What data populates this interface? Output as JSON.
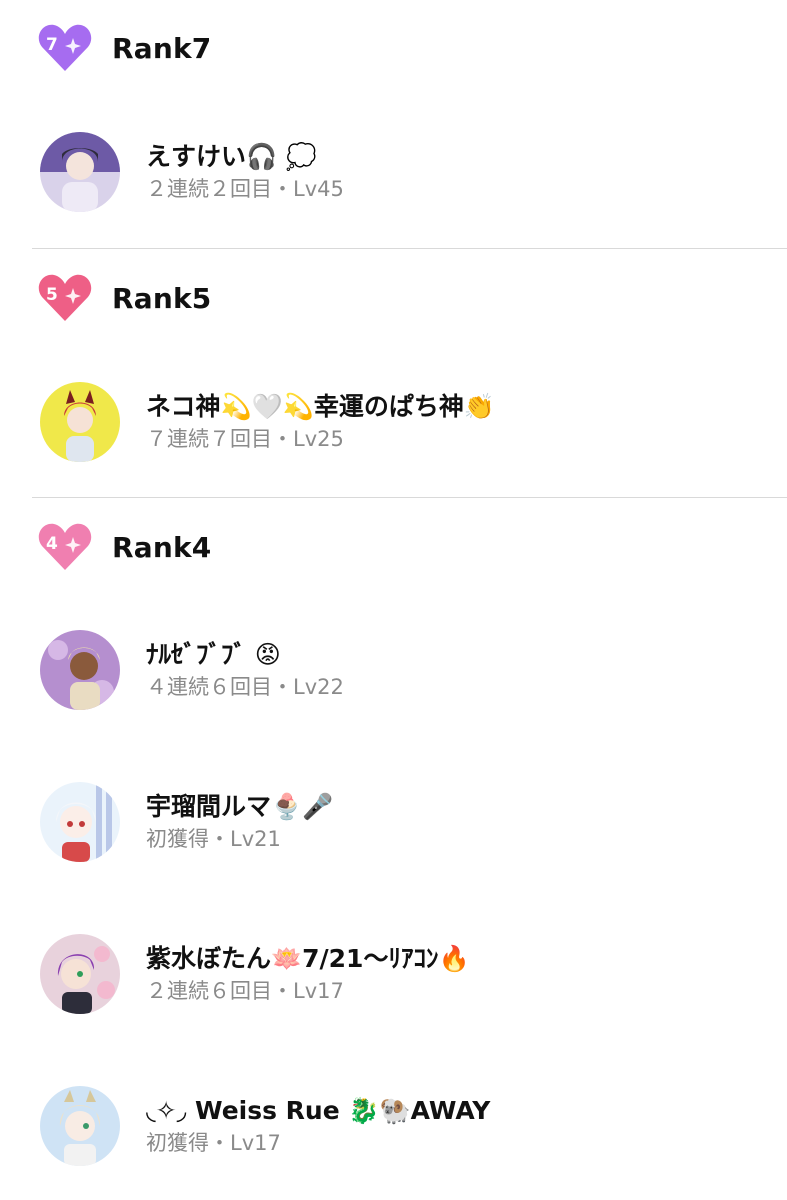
{
  "sections": [
    {
      "badge_number": "7",
      "badge_color": "#a66cf0",
      "title": "Rank7",
      "members": [
        {
          "name": "えすけい🎧 💭",
          "meta": "２連続２回目・Lv45",
          "avatar_colors": [
            "#6d5aa6",
            "#d9d2ea"
          ]
        }
      ]
    },
    {
      "badge_number": "5",
      "badge_color": "#ee5f86",
      "title": "Rank5",
      "members": [
        {
          "name": "ネコ神💫🤍💫幸運のぱち神👏",
          "meta": "７連続７回目・Lv25",
          "avatar_colors": [
            "#f0e84a",
            "#c93a3a"
          ]
        }
      ]
    },
    {
      "badge_number": "4",
      "badge_color": "#f07fb0",
      "title": "Rank4",
      "members": [
        {
          "name": "ﾅﾙｾﾞﾌﾞﾌﾞ 😡",
          "meta": "４連続６回目・Lv22",
          "avatar_colors": [
            "#b58fcf",
            "#8a5a3c"
          ]
        },
        {
          "name": "宇瑠間ルマ🍨🎤",
          "meta": "初獲得・Lv21",
          "avatar_colors": [
            "#eaf3fb",
            "#b9c7e8"
          ]
        },
        {
          "name": "紫水ぼたん🪷7/21〜ﾘｱｺﾝ🔥",
          "meta": "２連続６回目・Lv17",
          "avatar_colors": [
            "#e8d2dc",
            "#8a3fb0"
          ]
        },
        {
          "name": "◟✧◞ Weiss Rue 🐉🐏AWAY",
          "meta": "初獲得・Lv17",
          "avatar_colors": [
            "#cfe3f5",
            "#e9e2d0"
          ]
        }
      ]
    }
  ]
}
